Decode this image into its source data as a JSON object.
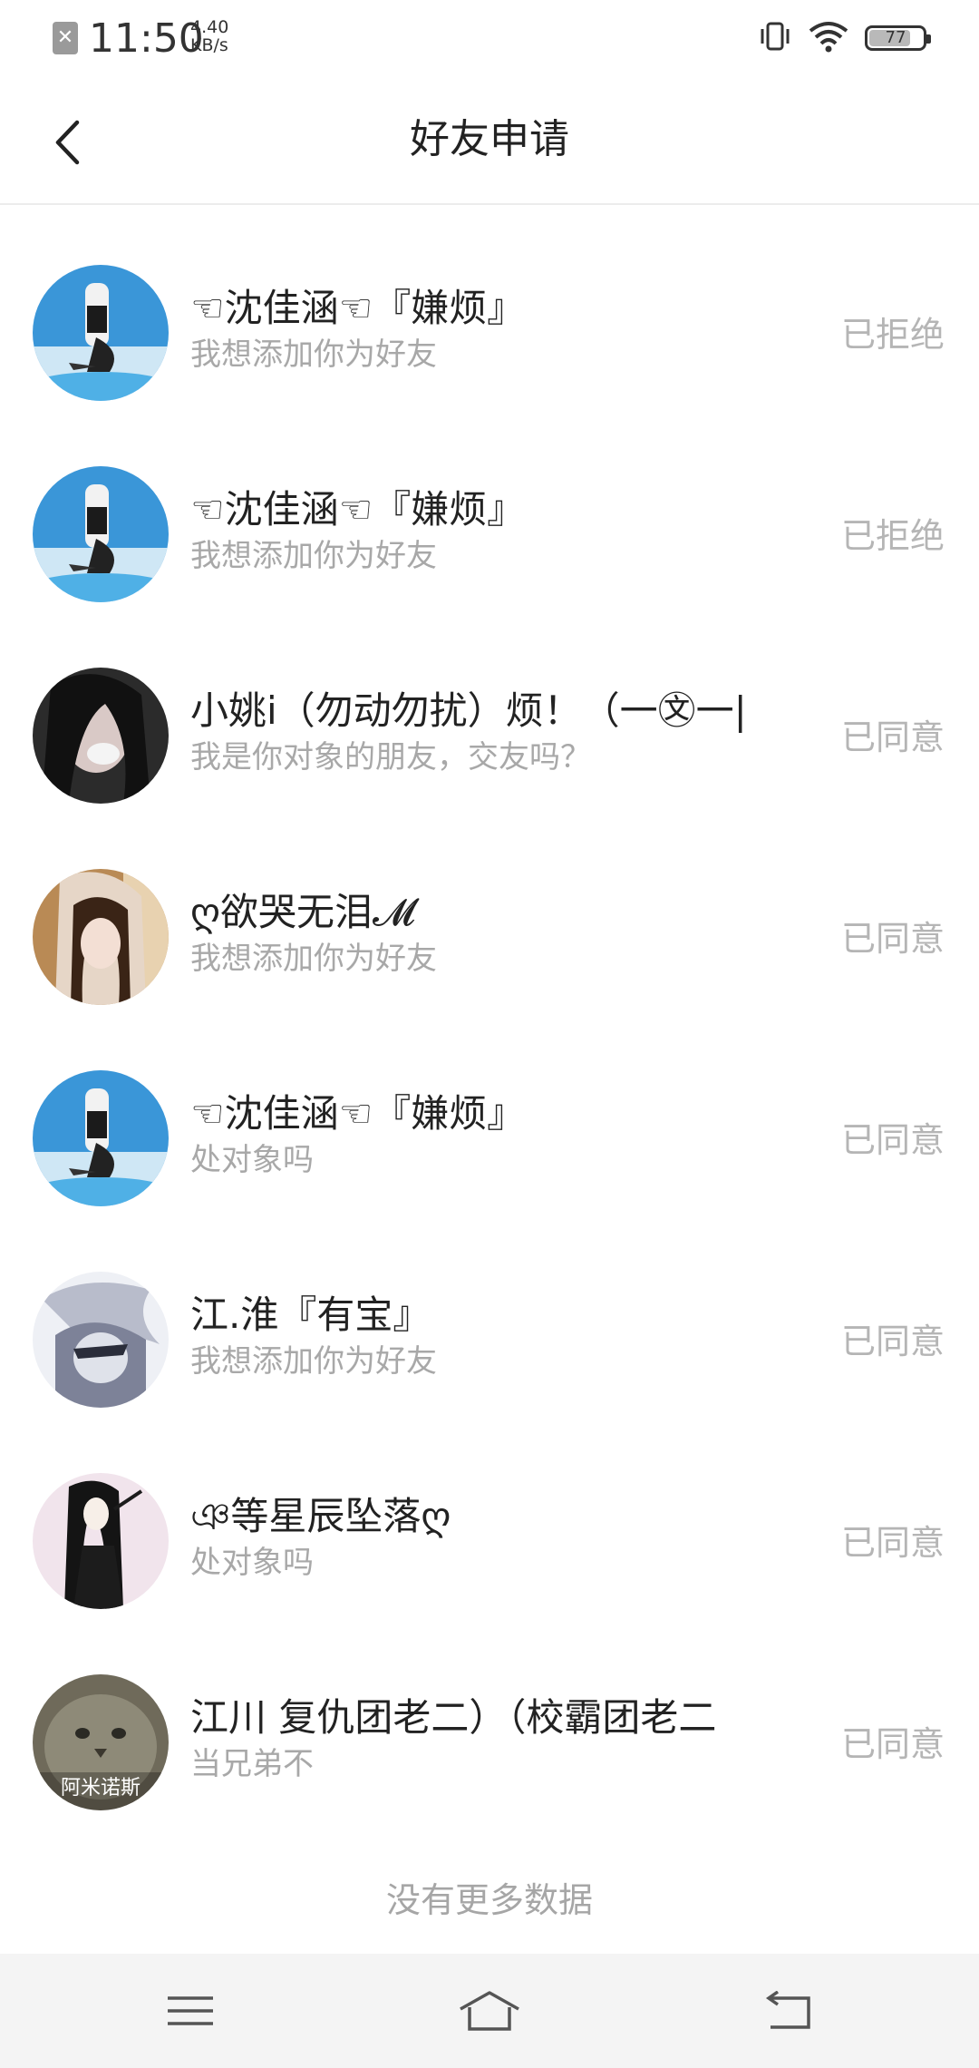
{
  "status_bar": {
    "time": "11:50",
    "net_speed_value": "4.40",
    "net_speed_unit": "KB/s",
    "battery_level": "77",
    "battery_fraction": 0.77,
    "icons": [
      "notification-blocked-icon",
      "vibrate-icon",
      "wifi-icon",
      "battery-icon"
    ]
  },
  "header": {
    "title": "好友申请",
    "back_icon": "back-arrow-icon"
  },
  "requests": [
    {
      "name": "☜沈佳涵☜『嫌烦』",
      "message": "我想添加你为好友",
      "status": "已拒绝",
      "avatar": "anime-girl-sky"
    },
    {
      "name": "☜沈佳涵☜『嫌烦』",
      "message": "我想添加你为好友",
      "status": "已拒绝",
      "avatar": "anime-girl-sky"
    },
    {
      "name": "小姚i（勿动勿扰）烦！（一㉆一|",
      "message": "我是你对象的朋友，交友吗？",
      "status": "已同意",
      "avatar": "dark-girl-photo"
    },
    {
      "name": "ღ欲哭无泪𝓜",
      "message": "我想添加你为好友",
      "status": "已同意",
      "avatar": "girl-hood-photo"
    },
    {
      "name": "☜沈佳涵☜『嫌烦』",
      "message": "处对象吗",
      "status": "已同意",
      "avatar": "anime-girl-sky"
    },
    {
      "name": "江.淮『有宝』",
      "message": "我想添加你为好友",
      "status": "已同意",
      "avatar": "anime-boy-sketch"
    },
    {
      "name": "ঞ等星辰坠落ღ",
      "message": "处对象吗",
      "status": "已同意",
      "avatar": "anime-girl-black-dress"
    },
    {
      "name": "江川 复仇团老二）（校霸团老二",
      "message": "当兄弟不",
      "status": "已同意",
      "avatar": "cat-photo",
      "avatar_caption": "阿米诺斯"
    }
  ],
  "footer": {
    "no_more": "没有更多数据"
  },
  "nav_bar": {
    "icons": [
      "menu-icon",
      "home-icon",
      "back-icon"
    ]
  },
  "colors": {
    "primary_text": "#222222",
    "secondary_text": "#a8a8a8",
    "status_text": "#b5b5b5",
    "nav_bg": "#f4f4f4"
  }
}
